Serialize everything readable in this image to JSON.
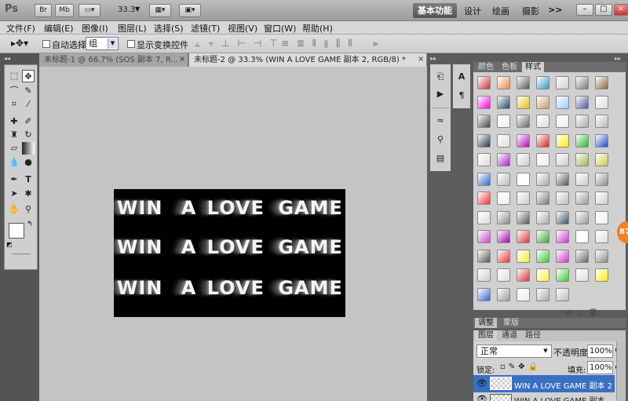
{
  "titlebar": {
    "logo": "Ps",
    "zoom": "33.3",
    "workspace_active": "基本功能",
    "workspaces": [
      "设计",
      "绘画",
      "摄影"
    ],
    "more": ">>"
  },
  "menus": [
    "文件(F)",
    "编辑(E)",
    "图像(I)",
    "图层(L)",
    "选择(S)",
    "滤镜(T)",
    "视图(V)",
    "窗口(W)",
    "帮助(H)"
  ],
  "options": {
    "auto_select_label": "自动选择:",
    "auto_select_value": "组",
    "show_transform_label": "显示变换控件"
  },
  "tabs": [
    {
      "label": "未标题-1 @ 66.7% (SOS 副本 7, R...",
      "close": "×"
    },
    {
      "label": "未标题-2 @ 33.3% (WIN A LOVE GAME 副本 2, RGB/8) *",
      "close": "×"
    }
  ],
  "canvas_text": {
    "word1": "WIN",
    "word2": "A",
    "word3": "LOVE",
    "word4": "GAME"
  },
  "right_panel": {
    "tabs_top": [
      "颜色",
      "色板",
      "样式"
    ],
    "tabs_mid": [
      "调整",
      "蒙版"
    ],
    "tabs_layers": [
      "图层",
      "通道",
      "路径"
    ],
    "blend_mode": "正常",
    "opacity_label": "不透明度:",
    "opacity_value": "100%",
    "lock_label": "锁定:",
    "fill_label": "填充:",
    "fill_value": "100%",
    "layers": [
      "WIN A LOVE GAME 副本 2",
      "WIN A LOVE GAME 副本"
    ]
  },
  "badge": "87",
  "colors": {
    "accent": "#3a6fc4",
    "panel": "#d0d0d0",
    "dark": "#5c5c5c"
  }
}
